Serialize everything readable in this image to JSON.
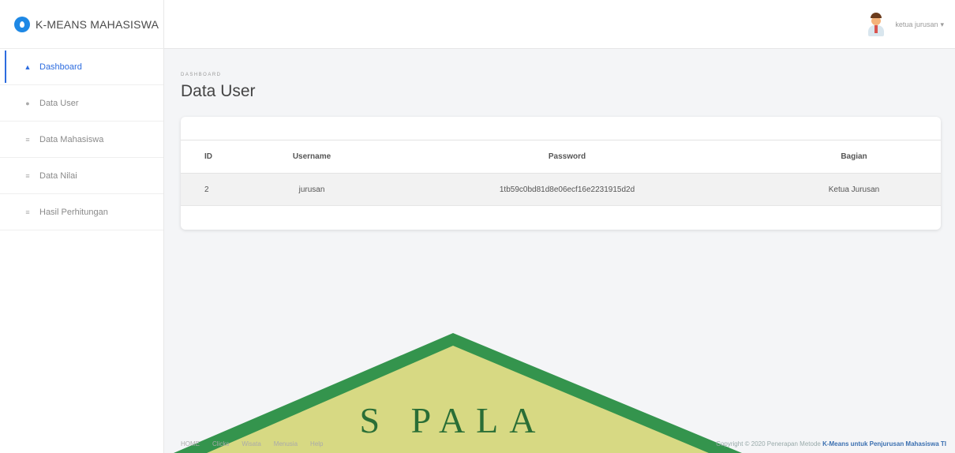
{
  "app": {
    "brand": "K-MEANS MAHASISWA"
  },
  "sidebar": {
    "items": [
      {
        "label": "Dashboard",
        "icon": "home-icon",
        "active": true
      },
      {
        "label": "Data User",
        "icon": "user-icon",
        "active": false
      },
      {
        "label": "Data Mahasiswa",
        "icon": "list-icon",
        "active": false
      },
      {
        "label": "Data Nilai",
        "icon": "list-icon",
        "active": false
      },
      {
        "label": "Hasil Perhitungan",
        "icon": "list-icon",
        "active": false
      }
    ]
  },
  "topbar": {
    "user_name": "ketua jurusan"
  },
  "page": {
    "breadcrumb": "DASHBOARD",
    "title": "Data User"
  },
  "table": {
    "headers": [
      "ID",
      "Username",
      "Password",
      "Bagian"
    ],
    "rows": [
      [
        "2",
        "jurusan",
        "1tb59c0bd81d8e06ecf16e2231915d2d",
        "Ketua Jurusan"
      ]
    ]
  },
  "watermark": {
    "text": "S PALA"
  },
  "footer": {
    "links": [
      "HOME",
      "Clicks",
      "Wisata",
      "Menusia",
      "Help"
    ],
    "copyright_prefix": "Copyright © 2020 Penerapan Metode",
    "copyright_bold": "K-Means untuk Penjurusan Mahasiswa TI"
  },
  "colors": {
    "accent": "#2d6cdf",
    "brand_logo": "#1e88e5",
    "watermark_green": "#1f8a3a",
    "watermark_yellow": "#e9e08a"
  }
}
